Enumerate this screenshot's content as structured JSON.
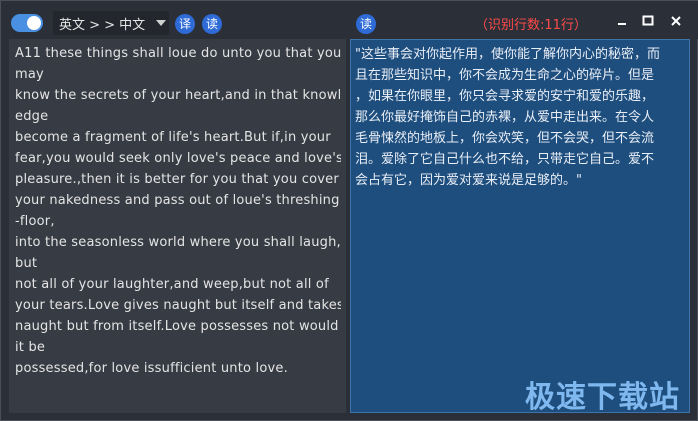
{
  "toolbar": {
    "lang_selector": "英文 > > 中文",
    "translate_btn": "译",
    "read_left_btn": "读",
    "read_right_btn": "读",
    "status": "（识别行数:11行）"
  },
  "left_panel": {
    "lines": [
      "A11 these things shall loue do unto you that you",
      " may",
      "know the secrets of your heart,and in that knowl",
      "edge",
      "become a fragment of life's heart.But if,in your",
      "fear,you would seek only love's peace and love's",
      "pleasure.,then it is better for you that you cover",
      "your nakedness and pass out of loue's threshing",
      "-floor,",
      "into the seasonless world where you shall laugh,",
      "but",
      "not all of your laughter,and weep,but not all of",
      "your tears.Love gives naught but itself and takes",
      "naught but from itself.Love possesses not would",
      "it be",
      "possessed,for love issufficient unto love."
    ]
  },
  "right_panel": {
    "lines": [
      "\"这些事会对你起作用，使你能了解你内心的秘密，而",
      "且在那些知识中，你不会成为生命之心的碎片。但是",
      "，如果在你眼里，你只会寻求爱的安宁和爱的乐趣，",
      "那么你最好掩饰自己的赤裸，从爱中走出来。在令人",
      "毛骨悚然的地板上，你会欢笑，但不会哭，但不会流",
      "泪。爱除了它自己什么也不给，只带走它自己。爱不",
      "会占有它，因为爱对爱来说是足够的。\""
    ]
  },
  "watermark": "极速下载站",
  "colors": {
    "accent": "#2e6bd6",
    "status": "#ff4a4a",
    "right_panel_bg": "#1e4e7e"
  }
}
